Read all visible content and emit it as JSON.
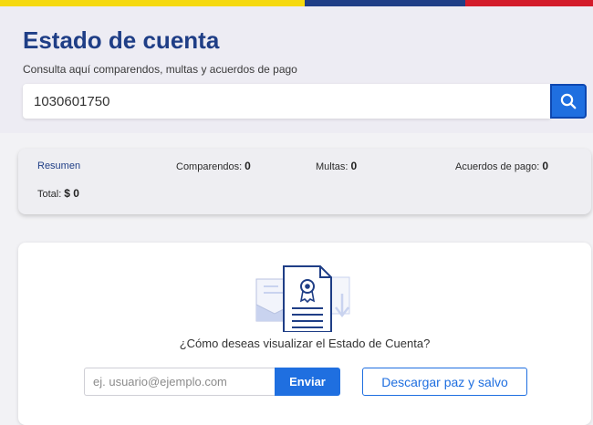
{
  "colors": {
    "flag_yellow": "#f5d90f",
    "flag_blue": "#1f3e86",
    "flag_red": "#d31b2a",
    "accent": "#1f6fe0"
  },
  "header": {
    "title": "Estado de cuenta",
    "subtitle": "Consulta aquí comparendos, multas y acuerdos de pago",
    "search_value": "1030601750",
    "search_icon": "search-icon"
  },
  "summary": {
    "resumen_label": "Resumen",
    "comparendos_label": "Comparendos:",
    "comparendos_value": "0",
    "multas_label": "Multas:",
    "multas_value": "0",
    "acuerdos_label": "Acuerdos de pago:",
    "acuerdos_value": "0",
    "total_label": "Total:",
    "total_value": "$ 0"
  },
  "main": {
    "illustration_icon": "certificate-document-icon",
    "question": "¿Cómo deseas visualizar el Estado de Cuenta?",
    "email_placeholder": "ej. usuario@ejemplo.com",
    "send_label": "Enviar",
    "download_label": "Descargar paz y salvo"
  }
}
